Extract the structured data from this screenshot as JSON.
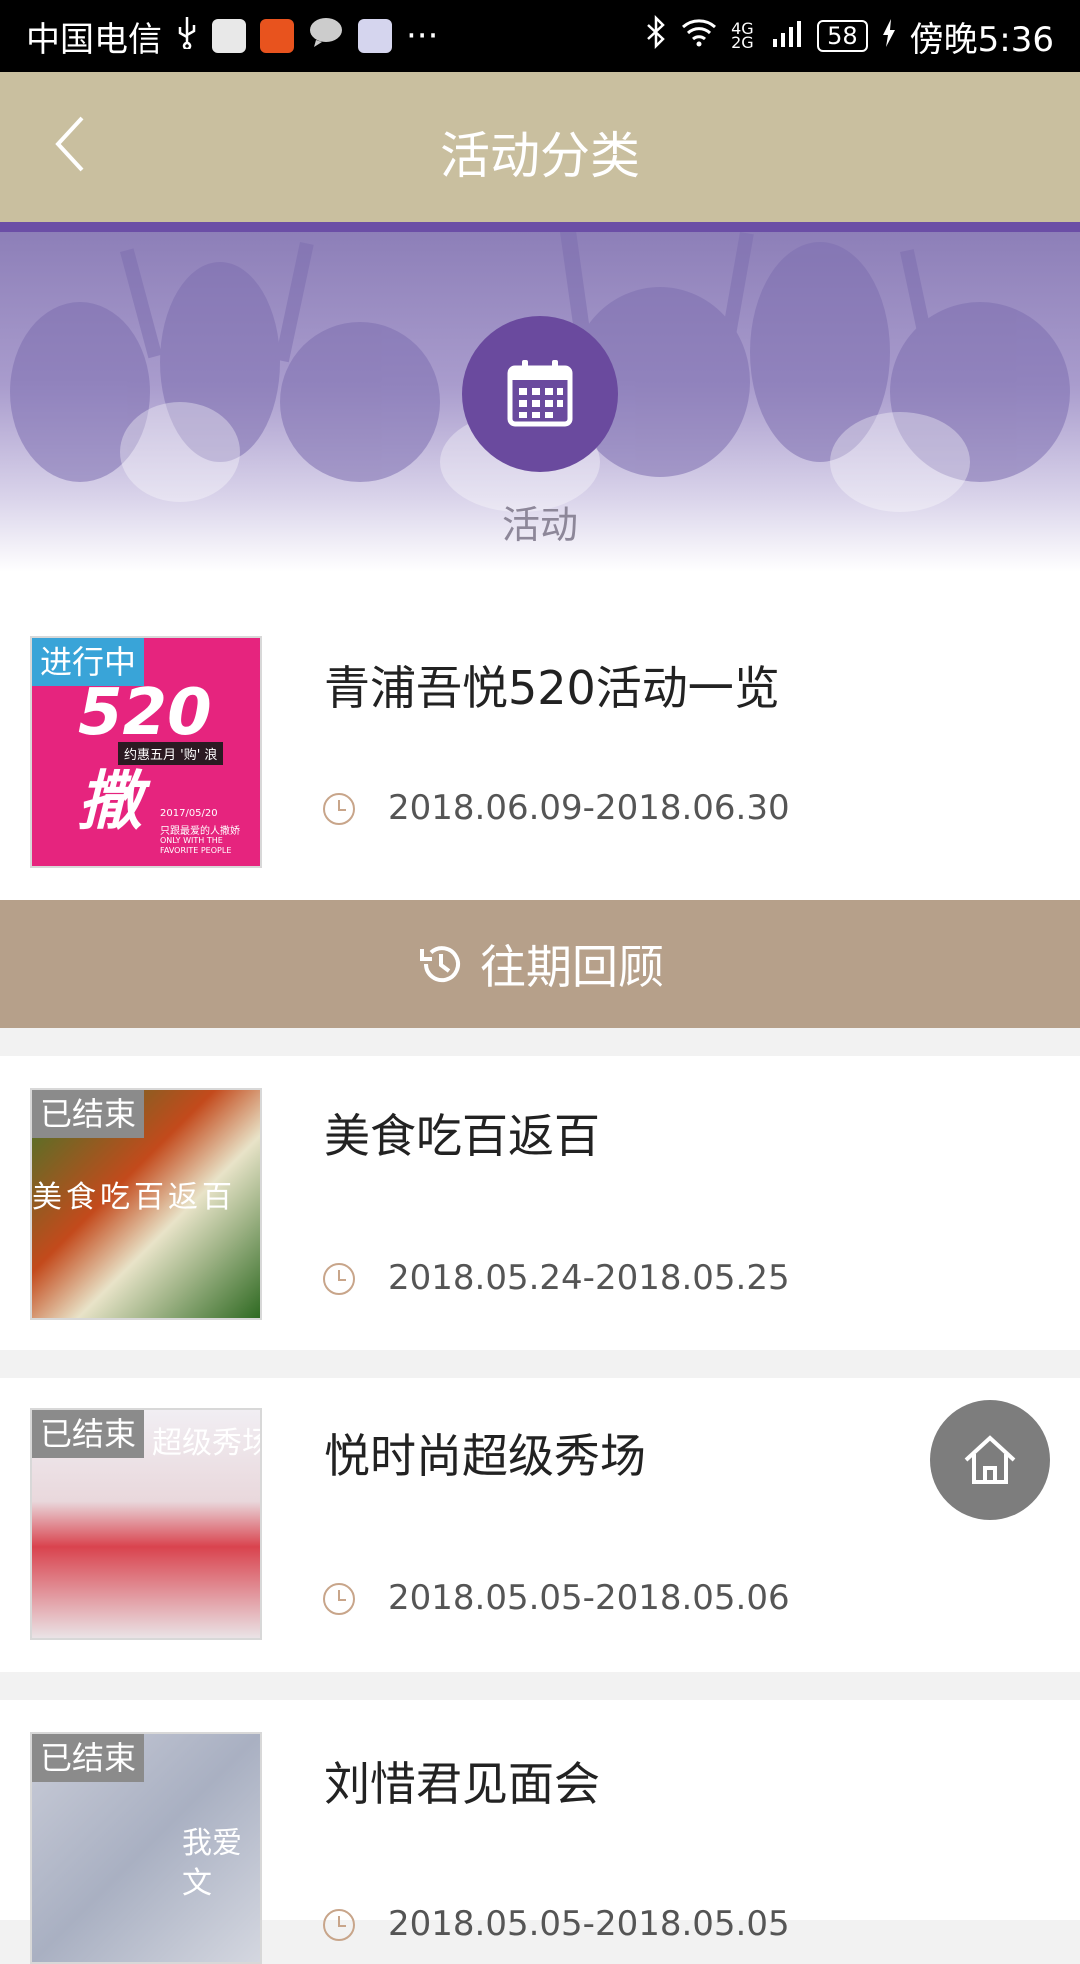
{
  "status_bar": {
    "carrier": "中国电信",
    "more": "···",
    "network": "4G 2G",
    "battery": "58",
    "time": "傍晚5:36"
  },
  "nav": {
    "title": "活动分类",
    "back_icon": "chevron-left-icon"
  },
  "banner": {
    "label": "活动",
    "icon": "calendar-icon"
  },
  "current": {
    "badge": "进行中",
    "title": "青浦吾悦520活动一览",
    "date": "2018.06.09-2018.06.30",
    "thumb": {
      "big_text": "520撒",
      "sub_text": "约惠五月 '购' 浪",
      "date_line": "2017/05/20",
      "tagline": "只跟最爱的人撒娇",
      "tagline_en": "ONLY WITH THE FAVORITE PEOPLE"
    }
  },
  "review": {
    "label": "往期回顾",
    "icon": "history-icon"
  },
  "past": [
    {
      "badge": "已结束",
      "title": "美食吃百返百",
      "date": "2018.05.24-2018.05.25",
      "thumb_text": "美食吃百返百"
    },
    {
      "badge": "已结束",
      "title": "悦时尚超级秀场",
      "date": "2018.05.05-2018.05.06",
      "thumb_text": "超级秀场"
    },
    {
      "badge": "已结束",
      "title": "刘惜君见面会",
      "date": "2018.05.05-2018.05.05",
      "thumb_text": "我爱文"
    }
  ],
  "home_button": {
    "icon": "home-icon"
  },
  "colors": {
    "nav": "#c9bf9f",
    "accent": "#6a4a9e",
    "review_bar": "#b6a08a",
    "ongoing_badge": "#39a4d8",
    "ended_badge": "#8b8b8b"
  }
}
